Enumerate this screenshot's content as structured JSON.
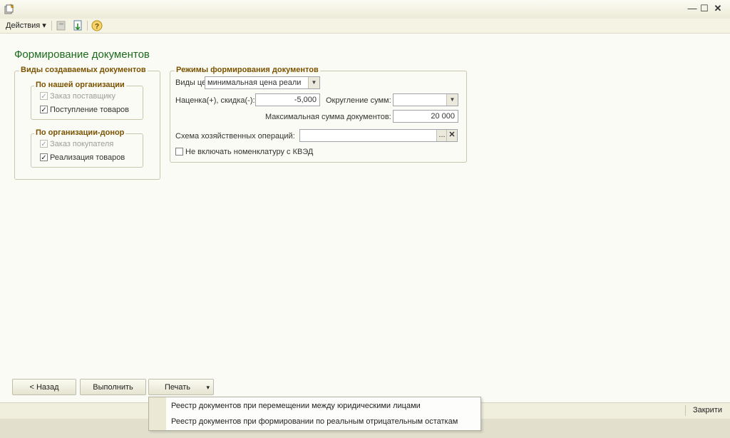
{
  "window": {
    "icon": "app-document-icon",
    "controls": [
      "minimize-icon",
      "maximize-icon",
      "close-icon"
    ],
    "minimize_glyph": "—",
    "maximize_glyph": "☐",
    "close_glyph": "✕"
  },
  "toolbar": {
    "actions_label": "Действия ▾",
    "icons": [
      "save-disabled-icon",
      "export-icon",
      "help-icon"
    ],
    "help_glyph": "?"
  },
  "form": {
    "title": "Формирование документов",
    "doc_types": {
      "title": "Виды создаваемых документов",
      "our_org": {
        "title": "По нашей организации",
        "items": [
          {
            "label": "Заказ поставщику",
            "checked": true,
            "enabled": false
          },
          {
            "label": "Поступление товаров",
            "checked": true,
            "enabled": true
          }
        ]
      },
      "donor_org": {
        "title": "По организации-донор",
        "items": [
          {
            "label": "Заказ покупателя",
            "checked": true,
            "enabled": false
          },
          {
            "label": "Реализация товаров",
            "checked": true,
            "enabled": true
          }
        ]
      }
    },
    "modes": {
      "title": "Режимы формирования документов",
      "price_type_label": "Виды цен:",
      "price_type_value": "минимальная цена реали",
      "markup_label": "Наценка(+), скидка(-):",
      "markup_value": "-5,000",
      "rounding_label": "Округление сумм:",
      "rounding_value": "",
      "max_sum_label": "Максимальная сумма документов:",
      "max_sum_value": "20 000",
      "scheme_label": "Схема хозяйственных операций:",
      "scheme_value": "",
      "scheme_select_glyph": "...",
      "scheme_clear_glyph": "✕",
      "exclude_kved_label": "Не включать номенклатуру с КВЭД",
      "exclude_kved_checked": false
    }
  },
  "buttons": {
    "back": "< Назад",
    "execute": "Выполнить",
    "print": "Печать",
    "print_arrow": "▾"
  },
  "print_menu": {
    "items": [
      "Реестр документов при перемещении между юридическими лицами",
      "Реестр документов при формировании по реальным отрицательным остаткам"
    ]
  },
  "status": {
    "close_label": "Закрити"
  },
  "colors": {
    "title_green": "#1c6a1c",
    "group_title_brown": "#7a5200",
    "background": "#fbfbf5"
  }
}
